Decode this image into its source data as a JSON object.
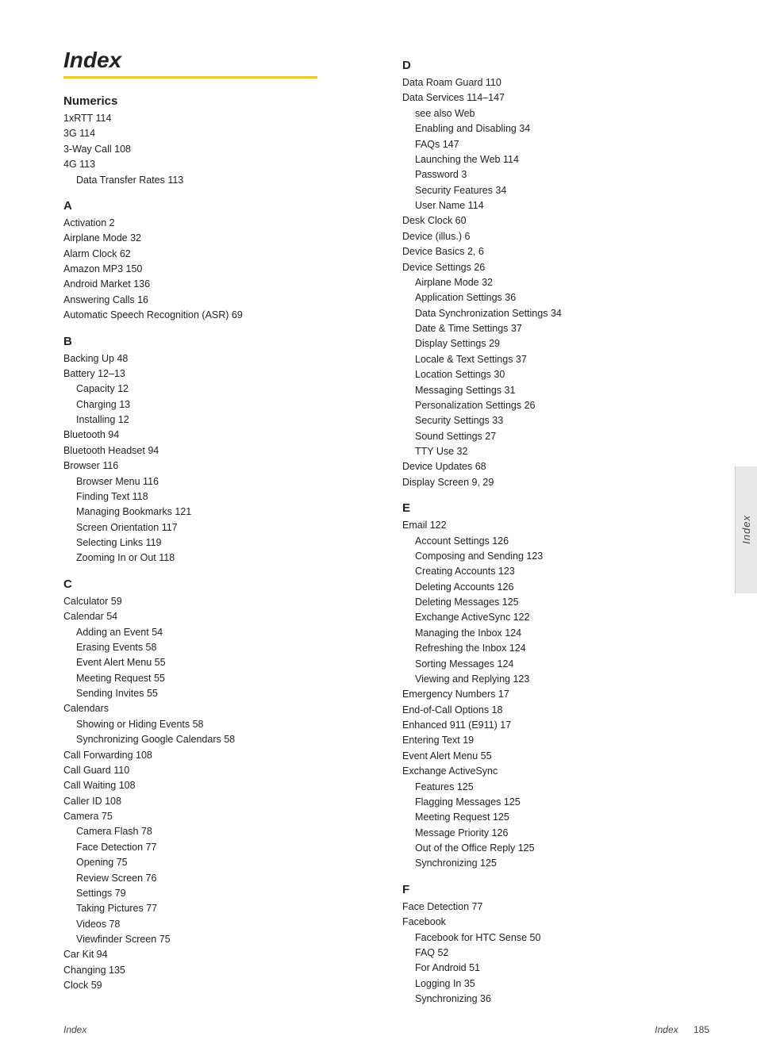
{
  "title": "Index",
  "underline_color": "#e8c830",
  "footer": {
    "label": "Index",
    "page": "185"
  },
  "side_tab": "Index",
  "left_column": [
    {
      "letter": "Numerics",
      "is_numerics": true,
      "entries": [
        {
          "level": 1,
          "text": "1xRTT 114"
        },
        {
          "level": 1,
          "text": "3G 114"
        },
        {
          "level": 1,
          "text": "3-Way Call 108"
        },
        {
          "level": 1,
          "text": "4G 113"
        },
        {
          "level": 2,
          "text": "Data Transfer Rates 113"
        }
      ]
    },
    {
      "letter": "A",
      "entries": [
        {
          "level": 1,
          "text": "Activation 2"
        },
        {
          "level": 1,
          "text": "Airplane Mode 32"
        },
        {
          "level": 1,
          "text": "Alarm Clock 62"
        },
        {
          "level": 1,
          "text": "Amazon MP3 150"
        },
        {
          "level": 1,
          "text": "Android Market 136"
        },
        {
          "level": 1,
          "text": "Answering Calls 16"
        },
        {
          "level": 1,
          "text": "Automatic Speech Recognition (ASR) 69"
        }
      ]
    },
    {
      "letter": "B",
      "entries": [
        {
          "level": 1,
          "text": "Backing Up 48"
        },
        {
          "level": 1,
          "text": "Battery 12–13"
        },
        {
          "level": 2,
          "text": "Capacity 12"
        },
        {
          "level": 2,
          "text": "Charging 13"
        },
        {
          "level": 2,
          "text": "Installing 12"
        },
        {
          "level": 1,
          "text": "Bluetooth 94"
        },
        {
          "level": 1,
          "text": "Bluetooth Headset 94"
        },
        {
          "level": 1,
          "text": "Browser 116"
        },
        {
          "level": 2,
          "text": "Browser Menu 116"
        },
        {
          "level": 2,
          "text": "Finding Text 118"
        },
        {
          "level": 2,
          "text": "Managing Bookmarks 121"
        },
        {
          "level": 2,
          "text": "Screen Orientation 117"
        },
        {
          "level": 2,
          "text": "Selecting Links 119"
        },
        {
          "level": 2,
          "text": "Zooming In or Out 118"
        }
      ]
    },
    {
      "letter": "C",
      "entries": [
        {
          "level": 1,
          "text": "Calculator 59"
        },
        {
          "level": 1,
          "text": "Calendar 54"
        },
        {
          "level": 2,
          "text": "Adding an Event 54"
        },
        {
          "level": 2,
          "text": "Erasing Events 58"
        },
        {
          "level": 2,
          "text": "Event Alert Menu 55"
        },
        {
          "level": 2,
          "text": "Meeting Request 55"
        },
        {
          "level": 2,
          "text": "Sending Invites 55"
        },
        {
          "level": 1,
          "text": "Calendars"
        },
        {
          "level": 2,
          "text": "Showing or Hiding Events 58"
        },
        {
          "level": 2,
          "text": "Synchronizing Google Calendars 58"
        },
        {
          "level": 1,
          "text": "Call Forwarding 108"
        },
        {
          "level": 1,
          "text": "Call Guard 110"
        },
        {
          "level": 1,
          "text": "Call Waiting 108"
        },
        {
          "level": 1,
          "text": "Caller ID 108"
        },
        {
          "level": 1,
          "text": "Camera 75"
        },
        {
          "level": 2,
          "text": "Camera Flash 78"
        },
        {
          "level": 2,
          "text": "Face Detection 77"
        },
        {
          "level": 2,
          "text": "Opening 75"
        },
        {
          "level": 2,
          "text": "Review Screen 76"
        },
        {
          "level": 2,
          "text": "Settings 79"
        },
        {
          "level": 2,
          "text": "Taking Pictures 77"
        },
        {
          "level": 2,
          "text": "Videos 78"
        },
        {
          "level": 2,
          "text": "Viewfinder Screen 75"
        },
        {
          "level": 1,
          "text": "Car Kit 94"
        },
        {
          "level": 1,
          "text": "Changing 135"
        },
        {
          "level": 1,
          "text": "Clock 59"
        }
      ]
    }
  ],
  "right_column": [
    {
      "letter": "D",
      "entries": [
        {
          "level": 1,
          "text": "Data Roam Guard 110"
        },
        {
          "level": 1,
          "text": "Data Services 114–147"
        },
        {
          "level": 2,
          "text": "see also Web"
        },
        {
          "level": 2,
          "text": "Enabling and Disabling 34"
        },
        {
          "level": 2,
          "text": "FAQs 147"
        },
        {
          "level": 2,
          "text": "Launching the Web 114"
        },
        {
          "level": 2,
          "text": "Password 3"
        },
        {
          "level": 2,
          "text": "Security Features 34"
        },
        {
          "level": 2,
          "text": "User Name 114"
        },
        {
          "level": 1,
          "text": "Desk Clock 60"
        },
        {
          "level": 1,
          "text": "Device (illus.) 6"
        },
        {
          "level": 1,
          "text": "Device Basics 2, 6"
        },
        {
          "level": 1,
          "text": "Device Settings 26"
        },
        {
          "level": 2,
          "text": "Airplane Mode 32"
        },
        {
          "level": 2,
          "text": "Application Settings 36"
        },
        {
          "level": 2,
          "text": "Data Synchronization Settings 34"
        },
        {
          "level": 2,
          "text": "Date & Time Settings 37"
        },
        {
          "level": 2,
          "text": "Display Settings 29"
        },
        {
          "level": 2,
          "text": "Locale & Text Settings 37"
        },
        {
          "level": 2,
          "text": "Location Settings 30"
        },
        {
          "level": 2,
          "text": "Messaging Settings 31"
        },
        {
          "level": 2,
          "text": "Personalization Settings 26"
        },
        {
          "level": 2,
          "text": "Security Settings 33"
        },
        {
          "level": 2,
          "text": "Sound Settings 27"
        },
        {
          "level": 2,
          "text": "TTY Use 32"
        },
        {
          "level": 1,
          "text": "Device Updates 68"
        },
        {
          "level": 1,
          "text": "Display Screen 9, 29"
        }
      ]
    },
    {
      "letter": "E",
      "entries": [
        {
          "level": 1,
          "text": "Email 122"
        },
        {
          "level": 2,
          "text": "Account Settings 126"
        },
        {
          "level": 2,
          "text": "Composing and Sending 123"
        },
        {
          "level": 2,
          "text": "Creating Accounts 123"
        },
        {
          "level": 2,
          "text": "Deleting Accounts 126"
        },
        {
          "level": 2,
          "text": "Deleting Messages 125"
        },
        {
          "level": 2,
          "text": "Exchange ActiveSync 122"
        },
        {
          "level": 2,
          "text": "Managing the Inbox 124"
        },
        {
          "level": 2,
          "text": "Refreshing the Inbox 124"
        },
        {
          "level": 2,
          "text": "Sorting Messages 124"
        },
        {
          "level": 2,
          "text": "Viewing and Replying 123"
        },
        {
          "level": 1,
          "text": "Emergency Numbers 17"
        },
        {
          "level": 1,
          "text": "End-of-Call Options 18"
        },
        {
          "level": 1,
          "text": "Enhanced 911 (E911) 17"
        },
        {
          "level": 1,
          "text": "Entering Text 19"
        },
        {
          "level": 1,
          "text": "Event Alert Menu 55"
        },
        {
          "level": 1,
          "text": "Exchange ActiveSync"
        },
        {
          "level": 2,
          "text": "Features 125"
        },
        {
          "level": 2,
          "text": "Flagging Messages 125"
        },
        {
          "level": 2,
          "text": "Meeting Request 125"
        },
        {
          "level": 2,
          "text": "Message Priority 126"
        },
        {
          "level": 2,
          "text": "Out of the Office Reply 125"
        },
        {
          "level": 2,
          "text": "Synchronizing 125"
        }
      ]
    },
    {
      "letter": "F",
      "entries": [
        {
          "level": 1,
          "text": "Face Detection 77"
        },
        {
          "level": 1,
          "text": "Facebook"
        },
        {
          "level": 2,
          "text": "Facebook for HTC Sense 50"
        },
        {
          "level": 2,
          "text": "FAQ 52"
        },
        {
          "level": 2,
          "text": "For Android 51"
        },
        {
          "level": 2,
          "text": "Logging In 35"
        },
        {
          "level": 2,
          "text": "Synchronizing 36"
        }
      ]
    }
  ]
}
